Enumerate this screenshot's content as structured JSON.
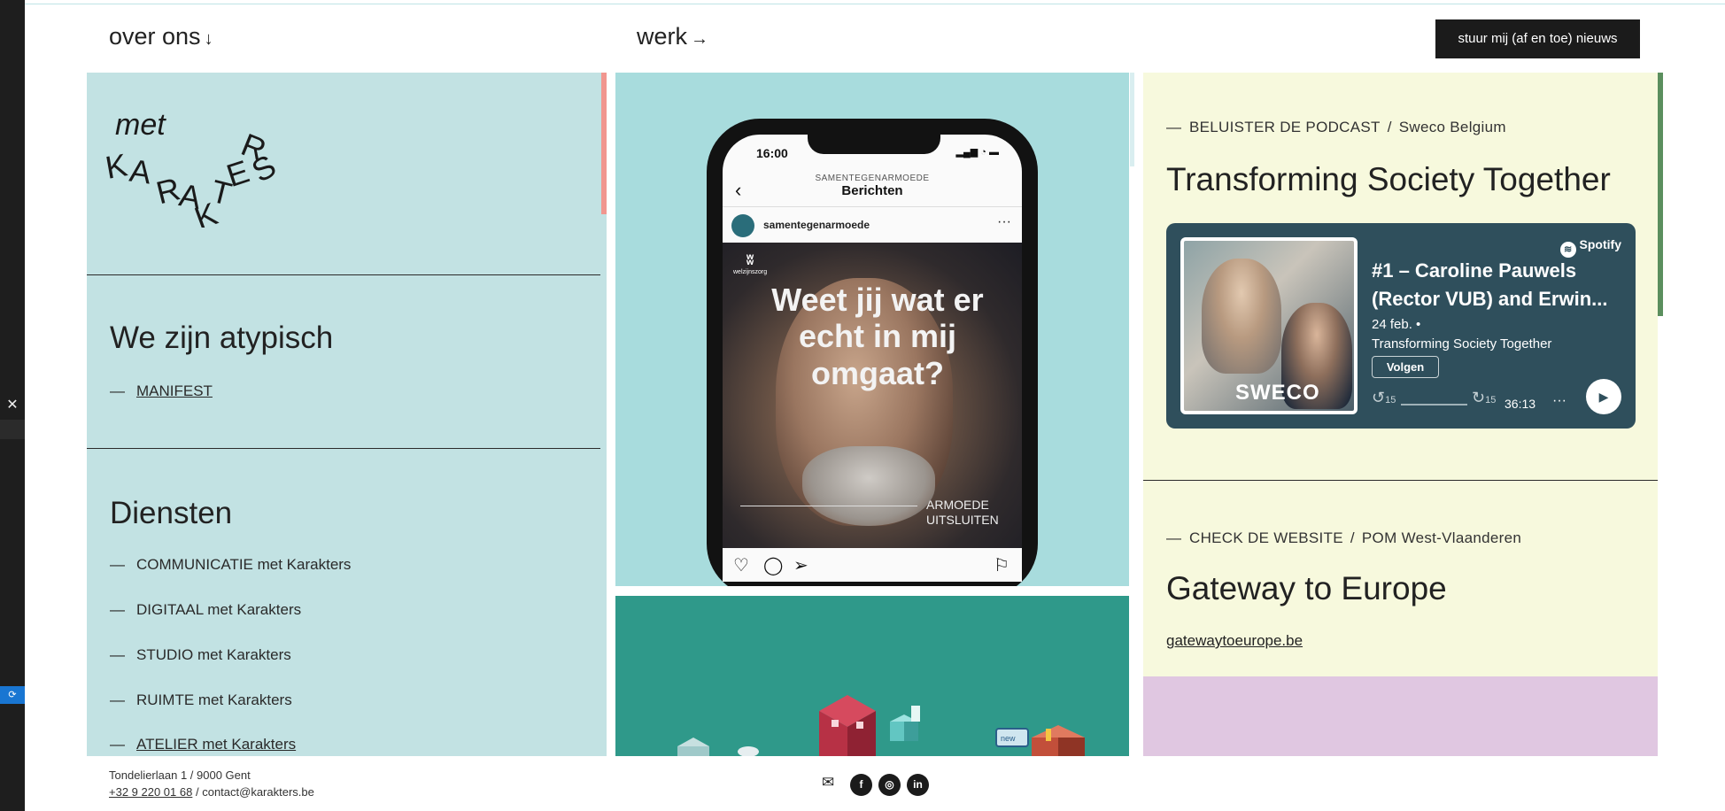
{
  "nav": {
    "about_label": "over ons",
    "about_arrow": "↓",
    "work_label": "werk",
    "work_arrow": "→",
    "newsletter_label": "stuur mij (af en toe) nieuws"
  },
  "logo": {
    "text": "met KARAKTERS",
    "word1": "met",
    "letters": [
      "K",
      "A",
      "R",
      "A",
      "K",
      "T",
      "E",
      "R",
      "S"
    ]
  },
  "about": {
    "heading": "We zijn atypisch",
    "link_label": "MANIFEST",
    "dash": "—"
  },
  "services": {
    "heading": "Diensten",
    "items": [
      {
        "label": "COMMUNICATIE met Karakters",
        "linked": false
      },
      {
        "label": "DIGITAAL met Karakters",
        "linked": false
      },
      {
        "label": "STUDIO met Karakters",
        "linked": false
      },
      {
        "label": "RUIMTE met Karakters",
        "linked": false
      },
      {
        "label": "ATELIER met Karakters",
        "linked": true
      }
    ]
  },
  "instagram_post": {
    "time": "16:00",
    "status_icons": "▂▄▆ ◔ ▬",
    "header_sub": "SAMENTEGENARMOEDE",
    "header_title": "Berichten",
    "account": "samentegenarmoede",
    "brand": "welzijnszorg",
    "quote": "Weet jij wat er echt in mij omgaat?",
    "tag_line1": "ARMOEDE",
    "tag_line2": "UITSLUITEN",
    "icons": [
      "heart-icon",
      "comment-icon",
      "share-icon",
      "bookmark-icon"
    ]
  },
  "podcast": {
    "dash": "—",
    "kicker": "BELUISTER DE PODCAST",
    "separator": "/",
    "client": "Sweco Belgium",
    "title": "Transforming Society Together",
    "player": {
      "brand": "Spotify",
      "cover_logo": "SWECO",
      "episode_line1": "#1 – Caroline Pauwels",
      "episode_line2": "(Rector VUB) and Erwin...",
      "date": "24 feb. •",
      "show": "Transforming Society Together",
      "follow_label": "Volgen",
      "skip_back": "15",
      "skip_forward": "15",
      "duration": "36:13",
      "more": "···",
      "progress": 0
    }
  },
  "website": {
    "dash": "—",
    "kicker": "CHECK DE WEBSITE",
    "separator": "/",
    "client": "POM West-Vlaanderen",
    "title": "Gateway to Europe",
    "link": "gatewaytoeurope.be"
  },
  "footer": {
    "address": "Tondelierlaan 1 / 9000 Gent",
    "phone": "+32 9 220 01 68",
    "separator": "/",
    "email": "contact@karakters.be",
    "social": [
      "facebook-icon",
      "instagram-icon",
      "linkedin-icon"
    ]
  },
  "colors": {
    "panel_blue": "#c2e2e3",
    "panel_teal": "#a8dcdd",
    "panel_green": "#2f998a",
    "panel_yellow": "#f7f9dd",
    "panel_purple": "#e0c7e1",
    "spotify_card": "#2f4f5c",
    "accent_salmon": "#f1968f",
    "accent_green": "#5b8f5e"
  }
}
